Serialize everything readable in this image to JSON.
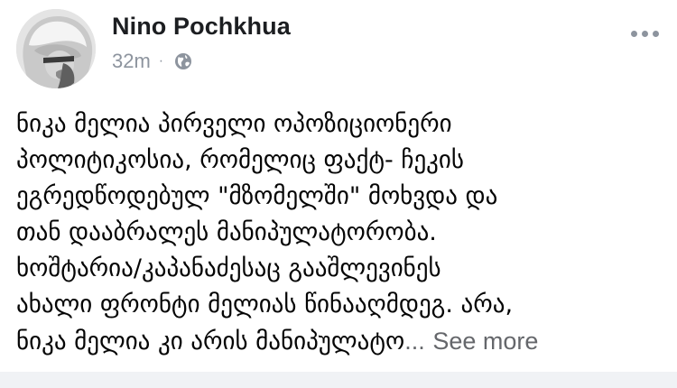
{
  "post": {
    "author": "Nino Pochkhua",
    "time": "32m",
    "separator": "·",
    "audience_icon": "globe-icon",
    "menu_icon": "more-options-icon",
    "lines": [
      "ნიკა მელია პირველი ოპოზიციონერი",
      "პოლიტიკოსია, რომელიც ფაქტ- ჩეკის",
      "ეგრედწოდებულ \"მზომელში\" მოხვდა და",
      "თან დააბრალეს მანიპულატორობა.",
      "ხოშტარია/კაპანაძესაც გააშლევინეს",
      "ახალი ფრონტი მელიას წინააღმდეგ. არა,"
    ],
    "last_line": "ნიკა მელია კი არის მანიპულატო",
    "ellipsis": "...",
    "see_more": "See more"
  },
  "colors": {
    "text": "#050505",
    "name": "#1c1e21",
    "meta": "#8d949e",
    "see_more": "#65676b",
    "feed_background": "#f0f2f5"
  }
}
